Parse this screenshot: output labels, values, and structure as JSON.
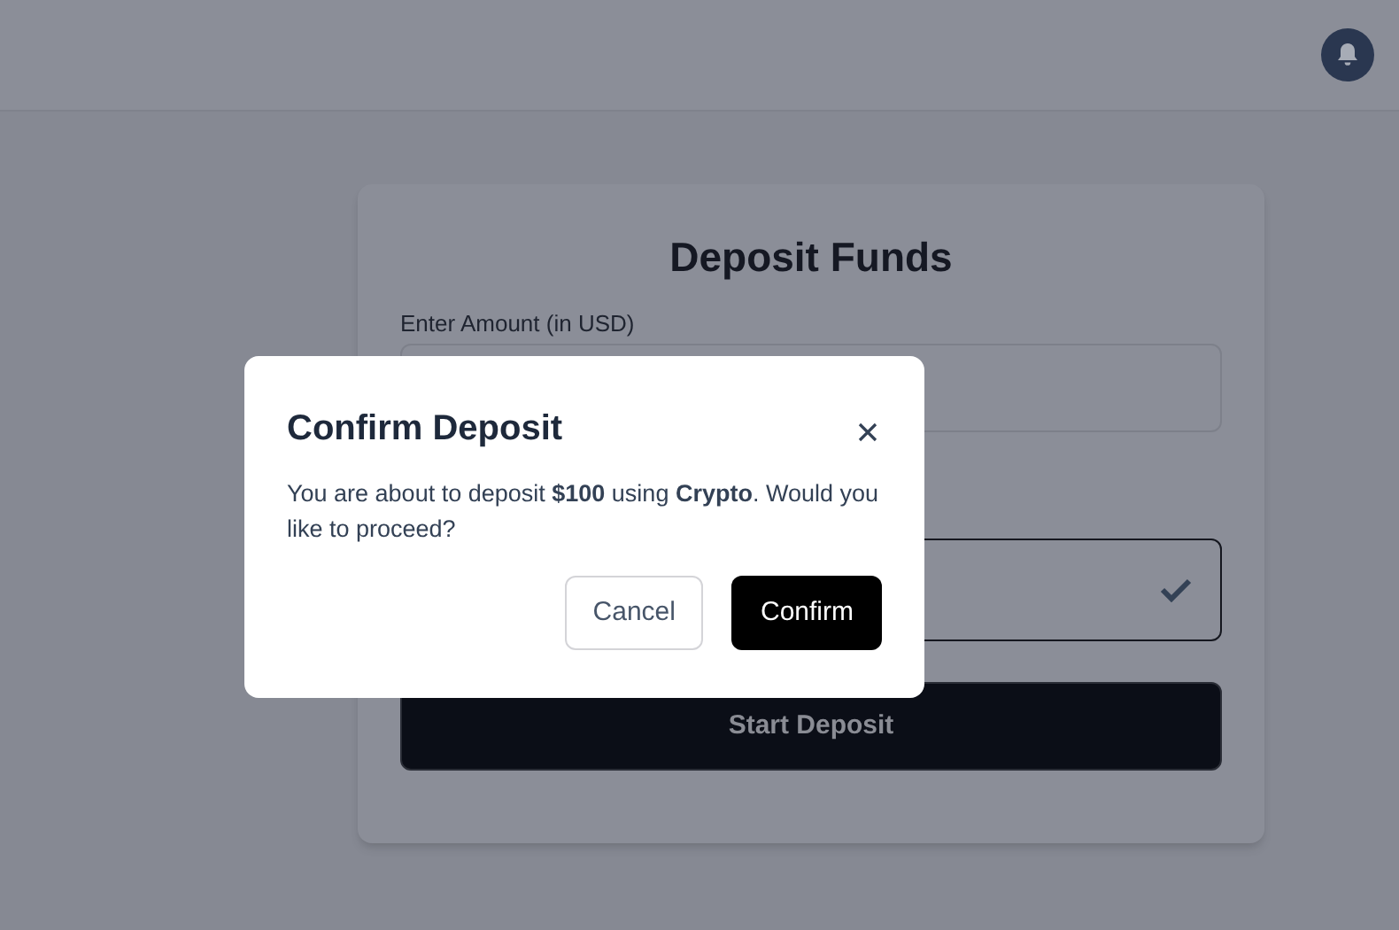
{
  "deposit_form": {
    "title": "Deposit Funds",
    "amount_label": "Enter Amount (in USD)",
    "payment_options": [
      {
        "selected": true
      }
    ],
    "submit_button": "Start Deposit"
  },
  "modal": {
    "title": "Confirm Deposit",
    "message": "You are about to deposit **$100** using **Crypto**. Would you like to proceed?",
    "buttons": [
      {
        "label": "Cancel",
        "kind": "secondary"
      },
      {
        "label": "Confirm",
        "kind": "primary"
      }
    ]
  }
}
